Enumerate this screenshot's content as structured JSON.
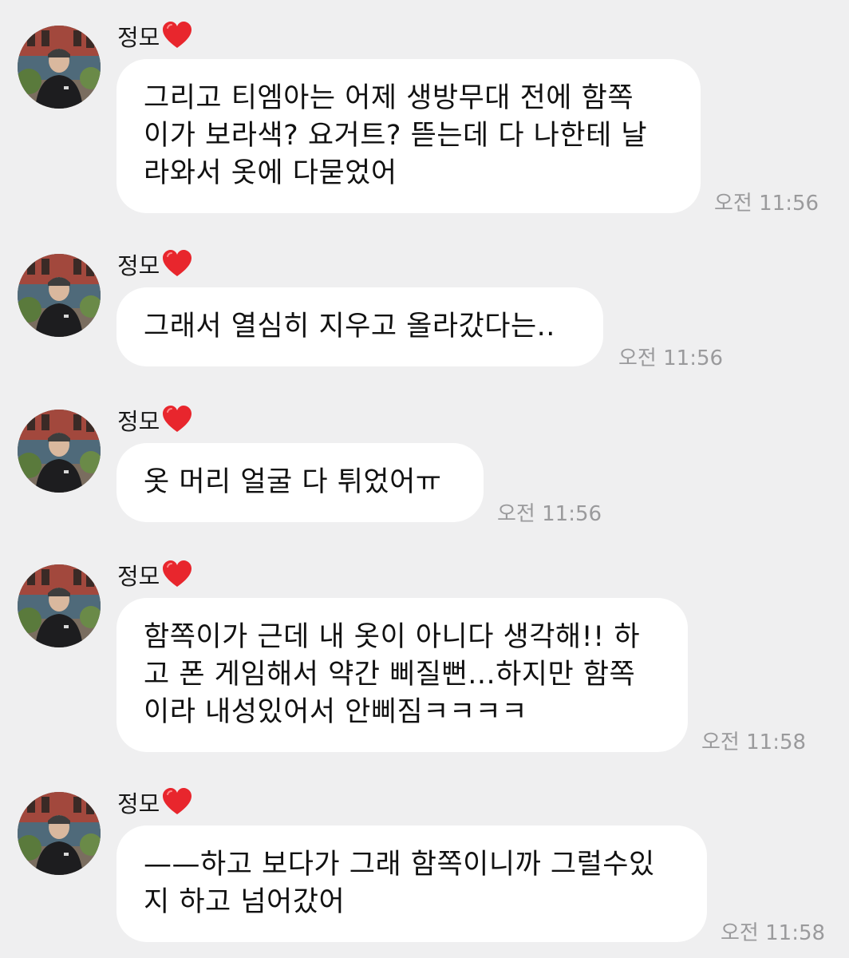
{
  "messages": [
    {
      "sender": "정모",
      "text": "그리고 티엠아는 어제 생방무대 전에 함쪽\n이가 보라색? 요거트? 뜯는데 다 나한테 날\n라와서 옷에 다묻었어",
      "time": "오전 11:56"
    },
    {
      "sender": "정모",
      "text": "그래서 열심히 지우고 올라갔다는..",
      "time": "오전 11:56"
    },
    {
      "sender": "정모",
      "text": "옷 머리 얼굴 다 튀었어ㅠ",
      "time": "오전 11:56"
    },
    {
      "sender": "정모",
      "text": "함쪽이가 근데 내 옷이 아니다 생각해!! 하\n고 폰 게임해서 약간 삐질뻔...하지만 함쪽\n이라 내성있어서 안삐짐ㅋㅋㅋㅋ",
      "time": "오전 11:58"
    },
    {
      "sender": "정모",
      "text": "——하고 보다가 그래 함쪽이니까 그럴수있\n지 하고 넘어갔어",
      "time": "오전 11:58"
    }
  ],
  "icons": {
    "sender_badge": "red-heart-icon",
    "avatar": "profile-avatar"
  },
  "colors": {
    "background": "#efeff0",
    "bubble": "#ffffff",
    "text": "#111111",
    "time": "#9a9a9c",
    "heart": "#e8262d"
  }
}
